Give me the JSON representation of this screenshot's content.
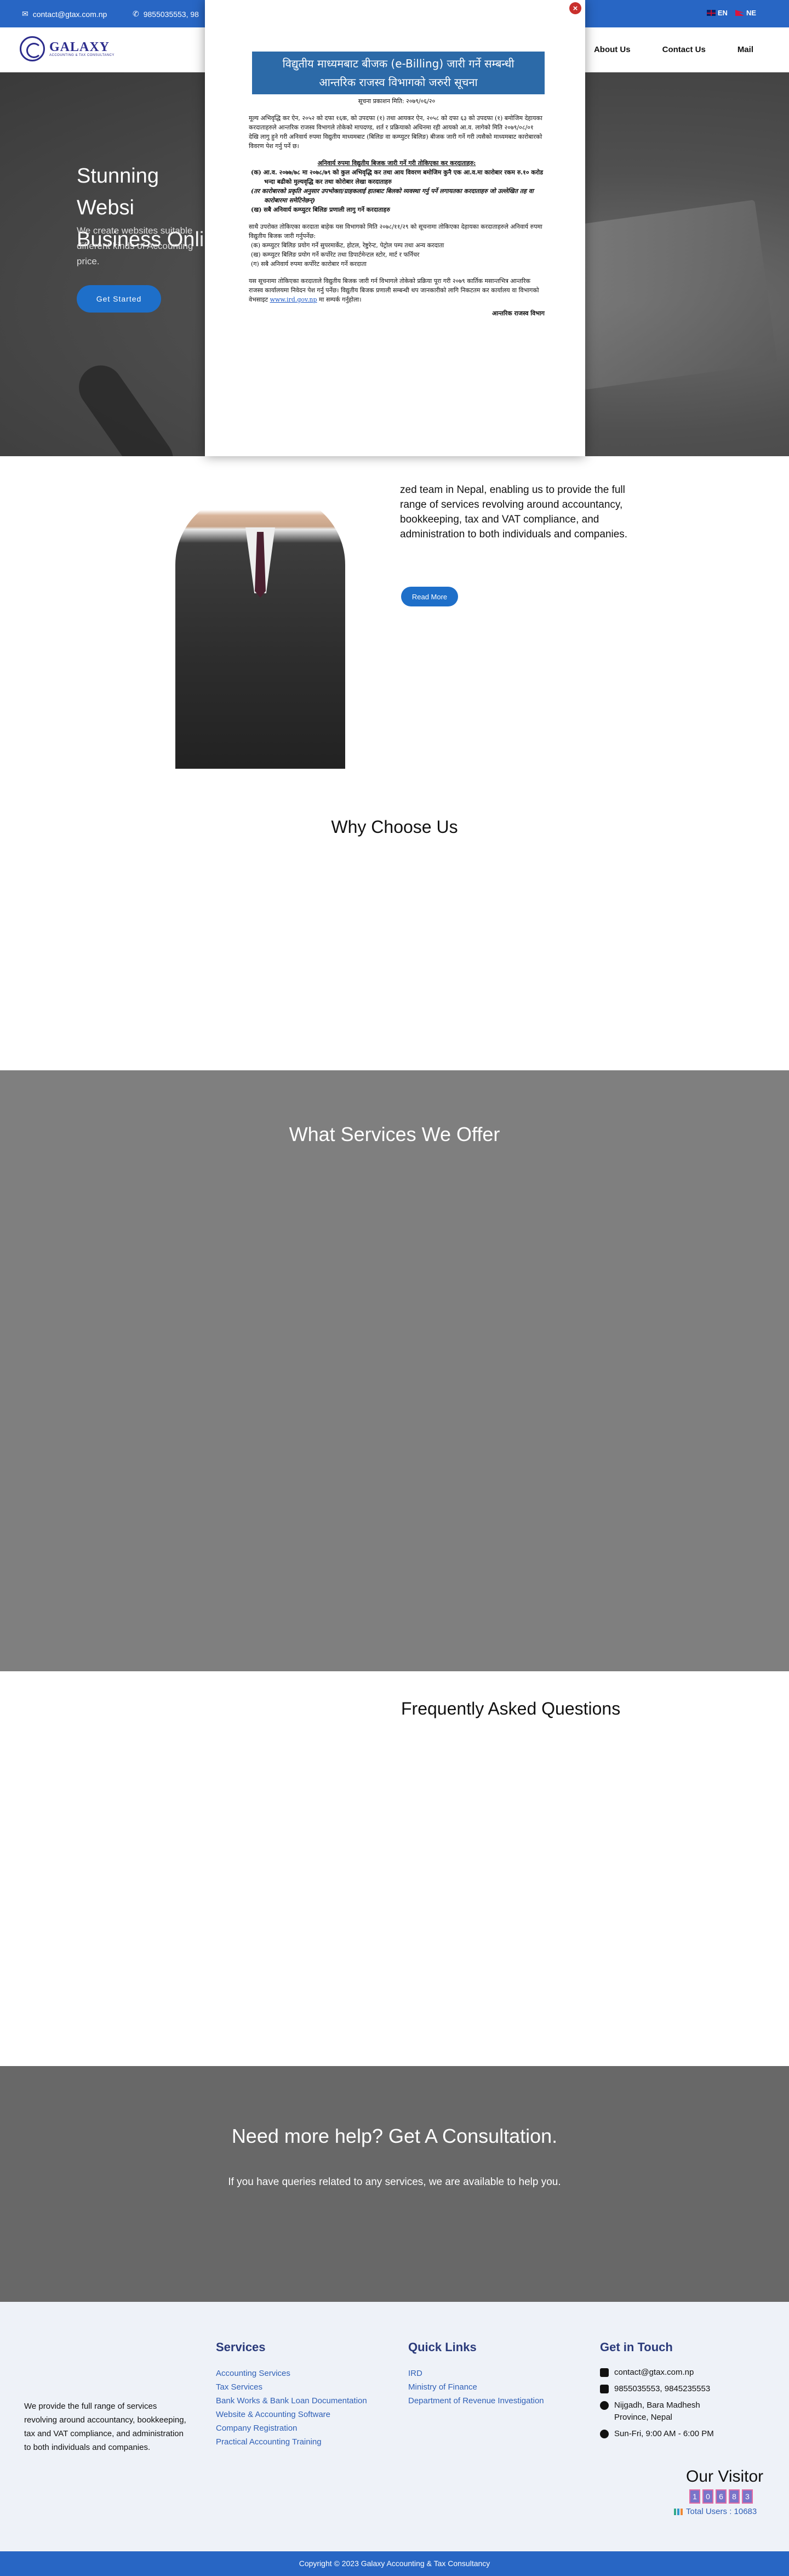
{
  "topbar": {
    "email": "contact@gtax.com.np",
    "phone": "9855035553, 98",
    "languages": [
      "EN",
      "NE"
    ]
  },
  "nav": {
    "logo_name": "GALAXY",
    "logo_tagline": "ACCOUNTING & TAX CONSULTANCY",
    "links": [
      "About Us",
      "Contact Us",
      "Mail"
    ]
  },
  "hero": {
    "title": "Stunning Websi Business Onlin",
    "text": "We create websites suitable different kinds of Accounting price.",
    "cta": "Get Started"
  },
  "about": {
    "text": "zed team in Nepal, enabling us to provide the full range of services revolving around accountancy, bookkeeping, tax and VAT compliance, and administration to both individuals and companies.",
    "button": "Read More"
  },
  "why": {
    "title": "Why Choose Us"
  },
  "services": {
    "title": "What Services We Offer"
  },
  "faq": {
    "title": "Frequently Asked Questions"
  },
  "consultation": {
    "title": "Need more help? Get A Consultation.",
    "text": "If you have queries related to any services, we are available to help you."
  },
  "footer": {
    "about": "We provide the full range of services revolving around accountancy, bookkeeping, tax and VAT compliance, and administration to both individuals and companies.",
    "services_title": "Services",
    "services": [
      "Accounting Services",
      "Tax Services",
      "Bank Works & Bank Loan Documentation",
      "Website & Accounting Software",
      "Company Registration",
      "Practical Accounting Training"
    ],
    "links_title": "Quick Links",
    "links": [
      "IRD",
      "Ministry of Finance",
      "Department of Revenue Investigation"
    ],
    "contact_title": "Get in Touch",
    "contact_email": "contact@gtax.com.np",
    "contact_phone": "9855035553, 9845235553",
    "contact_address": "Nijgadh, Bara Madhesh Province, Nepal",
    "contact_hours": "Sun-Fri, 9:00 AM - 6:00 PM",
    "visitor_title": "Our Visitor",
    "visitor_digits": [
      "1",
      "0",
      "6",
      "8",
      "3"
    ],
    "total_users": "Total Users : 10683"
  },
  "copyright": "Copyright © 2023 Galaxy Accounting & Tax Consultancy",
  "modal": {
    "close": "×",
    "head_line1": "विद्युतीय माध्यमबाट बीजक (e-Billing) जारी गर्ने सम्बन्धी",
    "head_line2": "आन्तरिक राजस्व विभागको जरुरी सूचना",
    "date": "सूचना प्रकाशन मिति: २०७९/०६/२०",
    "para1": "मूल्य अभिवृद्धि कर ऐन, २०५२ को दफा १६क, को उपदफा (१) तथा आयकर ऐन, २०५८ को दफा ६३ को उपदफा (१) बमोजिम देहायका करदाताहरुले आन्तरिक राजस्व विभागले तोकेको मापदण्ड, शर्त र प्रक्रियाको अधिनमा रही आयको आ.व. लागेको मिति २०७९/०८/०१ देखि लागु हुने गरी अनिवार्य रुपमा विद्युतीय माध्यमबाट (बिलिङ वा कम्प्युटर बिलिङ) बीजक जारी गर्ने गरी त्यसैको माध्यमबाट कारोबारको विवरण पेश गर्नु पर्ने छ।",
    "sub_heading": "अनिवार्य रुपमा विद्युतीय बिजक जारी गर्ने गरी तोकिएका कर करदाताहरु:",
    "items_a": [
      "(क) आ.व. २०७७/७८ मा २०७८/७९ को कुल अभिवृद्धि कर तथा आय विवरण बमोजिम कुनै एक आ.व.मा कारोबार रकम रु.१० करोड भन्दा बढीको मुल्यवृद्धि कर तथा कोरोबार लेखा करदाताहरु",
      "(तर कारोबारको प्रकृति अनुसार उपभोक्ता/ग्राहकलाई हातबाट बिलको व्यवस्था गर्नु पर्ने लगायतका करदाताहरु जो उल्लेखित तह वा कारोबारमा समेटिनेछन्)",
      "(ख) सबै अनिवार्य कम्प्युटर बिलिङ प्रणाली लागु गर्ने करदाताहरु"
    ],
    "para2": "साथै उपरोक्त तोकिएका करदाता बाहेक यस विभागको मिति २०७८/११/२९ को सूचनामा तोकिएका देहायका करदाताहरुले अनिवार्य रुपमा विद्युतीय बिजक जारी गर्नुपर्नेछ:",
    "items_b": [
      "(क) कम्प्युटर बिलिङ प्रयोग गर्ने सुपरमार्केट, होटल, रेष्टुरेन्ट, पेट्रोल पम्प तथा अन्य करदाता",
      "(ख) कम्प्युटर बिलिङ प्रयोग गर्ने कर्पोरेट तथा डिपार्टमेन्टल स्टोर, मार्ट र फर्निचर",
      "(ग) सबै अनिवार्य रुपमा कर्पोरेट कारोबार गर्ने करदाता"
    ],
    "para3": "यस सूचनामा तोकिएका करदाताले विद्युतीय बिजक जारी गर्न विभागले तोकेको प्रक्रिया पूरा गरी २०७९ कार्तिक मसान्तभित्र आन्तरिक राजस्व कार्यालयमा निवेदन पेश गर्नु पर्नेछ। विद्युतीय बिजक प्रणाली सम्बन्धी थप जानकारीको लागि निकटतम कर कार्यालय वा विभागको वेभसाइट",
    "site": "www.ird.gov.np",
    "para3_end": "मा सम्पर्क गर्नुहोला।",
    "sign": "आन्तरिक राजस्व विभाग"
  }
}
